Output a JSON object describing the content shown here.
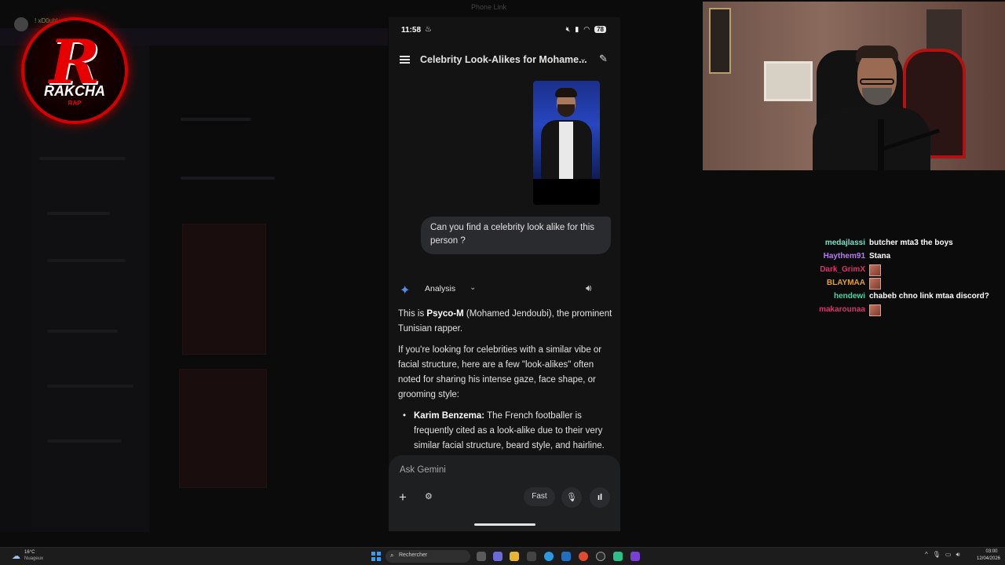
{
  "logo": {
    "letter": "R",
    "name": "RAKCHA",
    "tagline": "RAP"
  },
  "background": {
    "window_title": "Phone Link",
    "top_user": "! xD0ubl..."
  },
  "phone": {
    "status": {
      "time": "11:58",
      "battery": "78"
    },
    "appbar": {
      "title": "Celebrity Look-Alikes for Mohame..."
    },
    "user_message": "Can you find a celebrity look alike for this person ?",
    "response_header": {
      "mode": "Analysis"
    },
    "response": {
      "p1_bold": "Psyco-M",
      "p1_prefix": "This is ",
      "p1_suffix": " (Mohamed Jendoubi), the prominent Tunisian rapper.",
      "p2": "If you're looking for celebrities with a similar vibe or facial structure, here are a few \"look-alikes\" often noted for sharing his intense gaze, face shape, or grooming style:",
      "bullet_bold": "Karim Benzema:",
      "bullet_text": " The French footballer is frequently cited as a look-alike due to their very similar facial structure, beard style, and hairline."
    },
    "input": {
      "placeholder": "Ask Gemini",
      "fast_label": "Fast"
    }
  },
  "chat": {
    "messages": [
      {
        "user": "medajlassi",
        "color": "#7ee0c6",
        "text": "butcher mta3 the boys"
      },
      {
        "user": "Haythem91",
        "color": "#b77cf0",
        "text": "Stana"
      },
      {
        "user": "Dark_GrimX",
        "color": "#d9346a",
        "text": ""
      },
      {
        "user": "BLAYMAA",
        "color": "#e0a12a",
        "text": ""
      },
      {
        "user": "hendewi",
        "color": "#4fd2a6",
        "text": "chabeb chno link mtaa discord?"
      },
      {
        "user": "makarounaa",
        "color": "#d9346a",
        "text": ""
      }
    ]
  },
  "taskbar": {
    "weather_temp": "16°C",
    "weather_desc": "Nuageux",
    "search_label": "Rechercher",
    "clock_time": "03:00",
    "clock_date": "12/04/2026"
  }
}
